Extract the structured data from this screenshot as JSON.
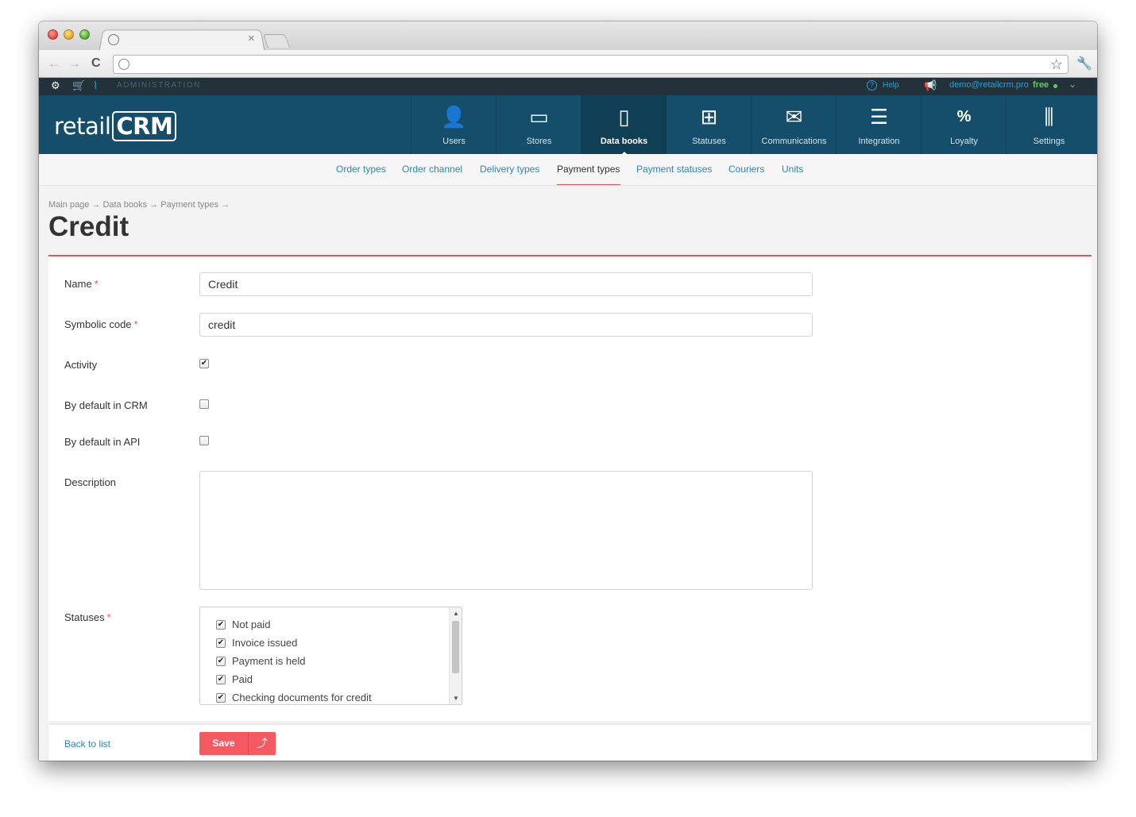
{
  "browser": {
    "tab_close": "×",
    "star": "☆",
    "wrench": "🔧",
    "back": "←",
    "forward": "→",
    "reload": "C"
  },
  "adminbar": {
    "label": "ADMINISTRATION",
    "help": "Help",
    "email": "demo@retailcrm.pro",
    "plan": "free"
  },
  "logo": {
    "text": "retail",
    "crm": "CRM"
  },
  "nav": {
    "items": [
      {
        "label": "Users",
        "icon": "user-icon",
        "glyph": "👤"
      },
      {
        "label": "Stores",
        "icon": "store-icon",
        "glyph": "▭"
      },
      {
        "label": "Data books",
        "icon": "book-icon",
        "glyph": "▯",
        "active": true
      },
      {
        "label": "Statuses",
        "icon": "statuses-icon",
        "glyph": "⊞"
      },
      {
        "label": "Communications",
        "icon": "envelope-icon",
        "glyph": "✉"
      },
      {
        "label": "Integration",
        "icon": "integration-icon",
        "glyph": "☰"
      },
      {
        "label": "Loyalty",
        "icon": "percent-tag-icon",
        "glyph": "%"
      },
      {
        "label": "Settings",
        "icon": "sliders-icon",
        "glyph": "⫼"
      }
    ]
  },
  "subnav": {
    "items": [
      "Order types",
      "Order channel",
      "Delivery types",
      "Payment types",
      "Payment statuses",
      "Couriers",
      "Units"
    ],
    "current": "Payment types"
  },
  "breadcrumb": "Main page → Data books → Payment types →",
  "page_title": "Credit",
  "form": {
    "name_label": "Name",
    "name_value": "Credit",
    "code_label": "Symbolic code",
    "code_value": "credit",
    "activity_label": "Activity",
    "activity_checked": true,
    "default_crm_label": "By default in CRM",
    "default_crm_checked": false,
    "default_api_label": "By default in API",
    "default_api_checked": false,
    "description_label": "Description",
    "description_value": "",
    "statuses_label": "Statuses",
    "required_mark": "*",
    "check_mark": "✔",
    "statuses": [
      {
        "label": "Not paid",
        "checked": true
      },
      {
        "label": "Invoice issued",
        "checked": true
      },
      {
        "label": "Payment is held",
        "checked": true
      },
      {
        "label": "Paid",
        "checked": true
      },
      {
        "label": "Checking documents for credit",
        "checked": true
      }
    ]
  },
  "footer": {
    "back_label": "Back to list",
    "save_label": "Save",
    "save_up_glyph": "⤴"
  },
  "colors": {
    "header_bg": "#154e6a",
    "accent_red": "#f55a63",
    "link_blue": "#2d86b4"
  }
}
